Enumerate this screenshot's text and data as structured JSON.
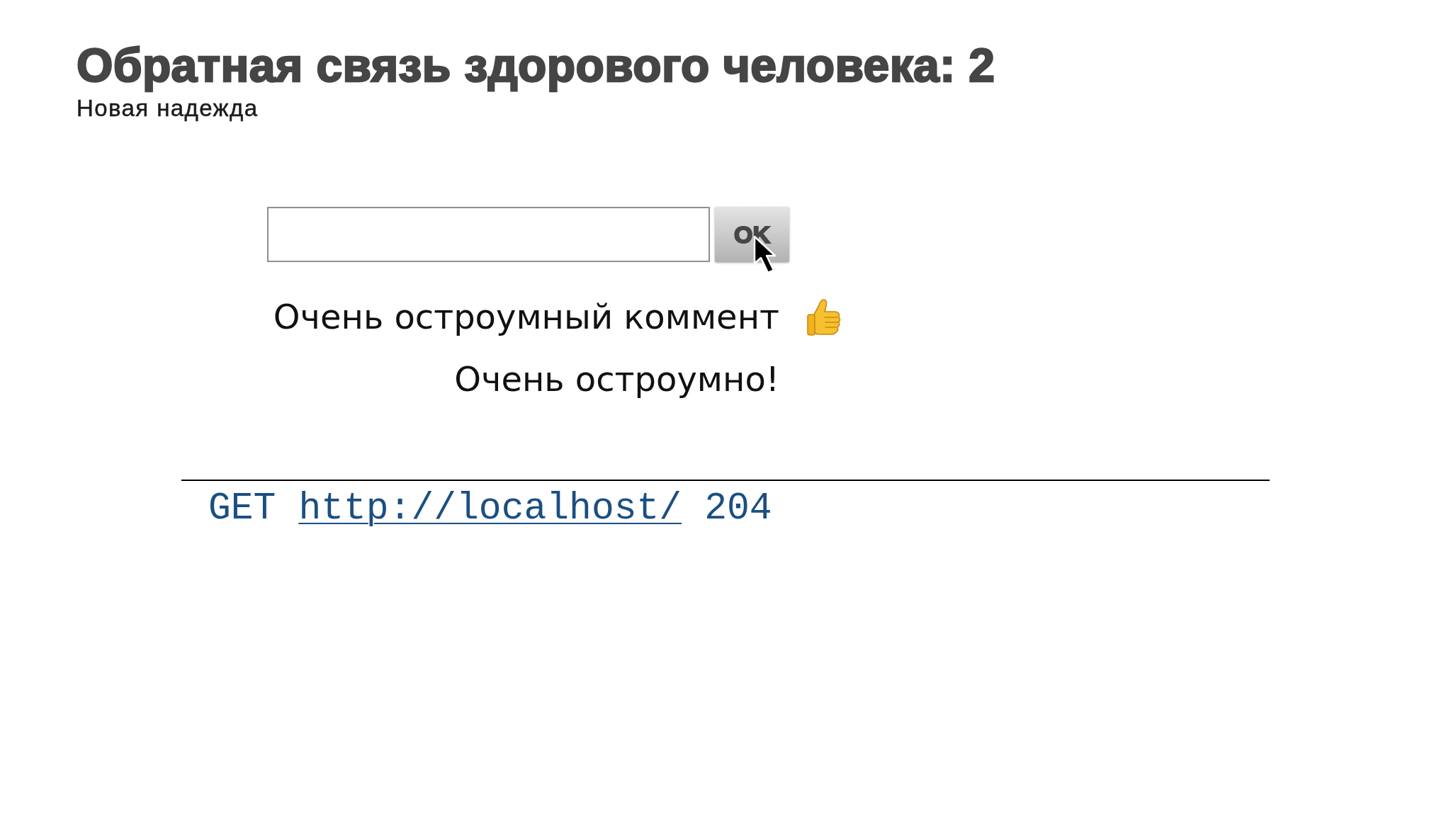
{
  "slide": {
    "title": "Обратная связь здорового человека: 2",
    "subtitle": "Новая надежда"
  },
  "form": {
    "button": "OK"
  },
  "comments": [
    {
      "text": "Очень остроумный коммент",
      "liked": true
    },
    {
      "text": "Очень остроумно!",
      "liked": false
    }
  ],
  "request_log": [
    {
      "method": "GET",
      "url": "http://localhost/",
      "status": "204"
    }
  ]
}
